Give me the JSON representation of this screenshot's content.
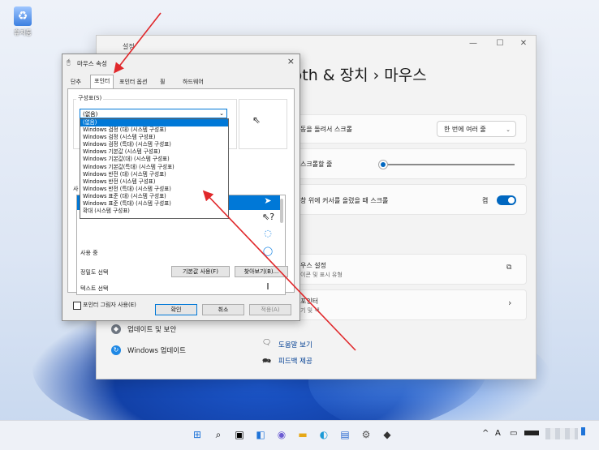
{
  "desktop": {
    "recycle_bin_label": "휴지통"
  },
  "settings": {
    "window_title": "설정",
    "win_controls": [
      "—",
      "☐",
      "✕"
    ],
    "heading": "ooth & 장치  ›  마우스",
    "rows": [
      {
        "label": "동을 돌려서 스크롤",
        "value": "한 번에 여러 줄"
      },
      {
        "label": "스크롤할 줄"
      },
      {
        "label": "창 위에 커서를 올렸을 때 스크롤",
        "value": "켬"
      },
      {
        "label": "우스 설정",
        "sub": "이콘 및 표시 유형"
      },
      {
        "label": "포인터",
        "sub": "기 및 색"
      }
    ],
    "scroll_lines_fraction": 0.03,
    "nav": [
      {
        "label": "업데이트 및 보안"
      },
      {
        "label": "Windows 업데이트"
      }
    ],
    "help": [
      {
        "label": "도움말 보기"
      },
      {
        "label": "피드백 제공"
      }
    ]
  },
  "dialog": {
    "title": "마우스 속성",
    "close": "×",
    "tabs": [
      "단추",
      "포인터",
      "포인터 옵션",
      "휠",
      "하드웨어"
    ],
    "active_tab": "포인터",
    "scheme_group_label": "구성표(S)",
    "scheme_selected": "(없음)",
    "scheme_options": [
      "(없음)",
      "Windows 검정 (대) (시스템 구성표)",
      "Windows 검정 (시스템 구성표)",
      "Windows 검정 (특대) (시스템 구성표)",
      "Windows 기본값 (시스템 구성표)",
      "Windows 기본값(대) (시스템 구성표)",
      "Windows 기본값(특대) (시스템 구성표)",
      "Windows 반전 (대) (시스템 구성표)",
      "Windows 반전 (시스템 구성표)",
      "Windows 반전 (특대) (시스템 구성표)",
      "Windows 표준 (대) (시스템 구성표)",
      "Windows 표준 (특대) (시스템 구성표)",
      "확대 (시스템 구성표)"
    ],
    "customize_label": "사",
    "cursor_rows": [
      {
        "label": "",
        "icon": "pointer-arrow-icon"
      },
      {
        "label": "",
        "icon": "help-select-icon"
      },
      {
        "label": "",
        "icon": "working-in-background-icon"
      },
      {
        "label": "사용 중",
        "icon": "busy-icon"
      },
      {
        "label": "정밀도 선택",
        "icon": "precision-select-icon"
      },
      {
        "label": "텍스트 선택",
        "icon": "text-select-icon"
      }
    ],
    "shadow_checkbox": "포인터 그림자 사용(E)",
    "use_default_button": "기본값 사용(F)",
    "browse_button": "찾아보기(B)...",
    "ok_button": "확인",
    "cancel_button": "취소",
    "apply_button": "적용(A)"
  },
  "taskbar": {
    "icons": [
      "start-icon",
      "search-icon",
      "task-view-icon",
      "widgets-icon",
      "chat-icon",
      "file-explorer-icon",
      "edge-icon",
      "store-icon",
      "settings-icon",
      "app-icon"
    ],
    "tray_chevron": "^",
    "tray_input": "A"
  },
  "colors": {
    "accent": "#0078d7",
    "annotation": "#e0282b"
  }
}
